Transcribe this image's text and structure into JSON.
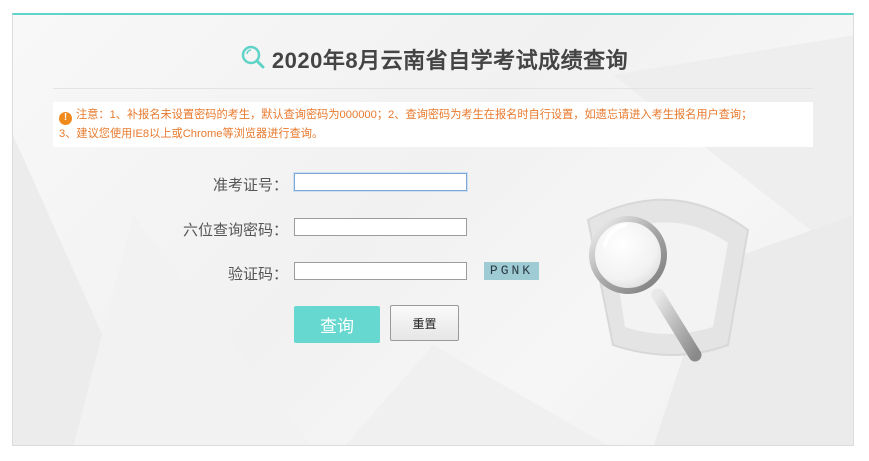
{
  "header": {
    "title": "2020年8月云南省自学考试成绩查询",
    "icon": "search-icon"
  },
  "notice": {
    "icon": "exclamation-icon",
    "icon_glyph": "!",
    "line1": "注意：1、补报名未设置密码的考生，默认查询密码为000000；2、查询密码为考生在报名时自行设置，如遗忘请进入考生报名用户查询；",
    "line2": "3、建议您使用IE8以上或Chrome等浏览器进行查询。"
  },
  "form": {
    "exam_id_label": "准考证号：",
    "exam_id_value": "",
    "password_label": "六位查询密码：",
    "password_value": "",
    "captcha_label": "验证码：",
    "captcha_value": "",
    "captcha_code": "PGNK"
  },
  "buttons": {
    "query_label": "查询",
    "reset_label": "重置"
  },
  "colors": {
    "accent": "#5fd3c8",
    "notice_text": "#e8792c",
    "captcha_bg": "#9ecbd4"
  }
}
